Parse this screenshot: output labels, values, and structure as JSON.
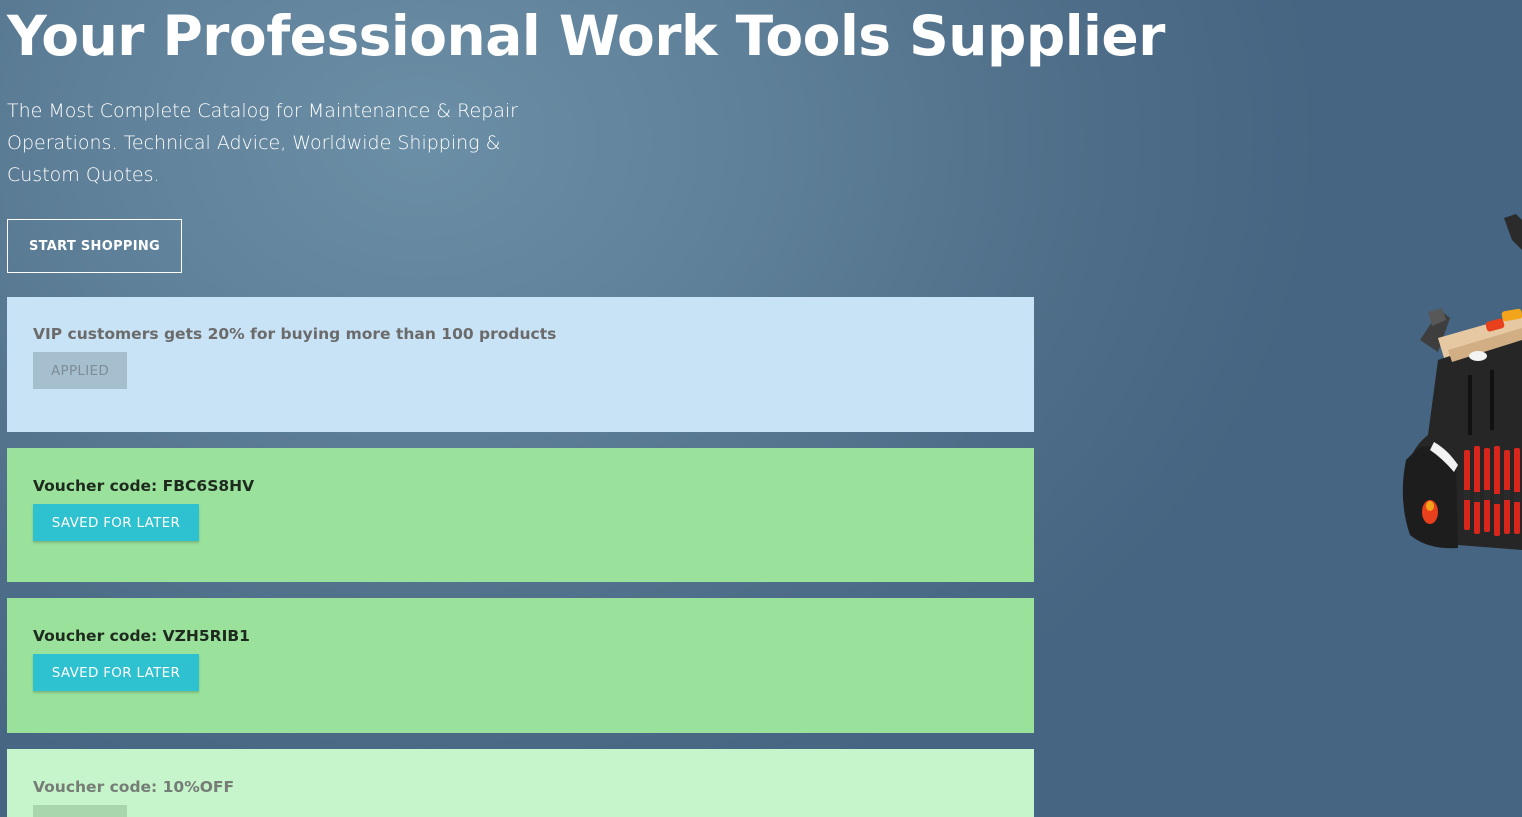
{
  "hero": {
    "title": "Your Professional Work Tools Supplier",
    "subtitle": "The Most Complete Catalog for Maintenance & Repair Operations. Technical Advice, Worldwide Shipping & Custom Quotes.",
    "cta_label": "START SHOPPING"
  },
  "vouchers": [
    {
      "text": "VIP customers gets 20% for buying more than 100 products",
      "button_label": "APPLIED",
      "state": "applied"
    },
    {
      "text": "Voucher code: FBC6S8HV",
      "button_label": "SAVED FOR LATER",
      "state": "saved"
    },
    {
      "text": "Voucher code: VZH5RIB1",
      "button_label": "SAVED FOR LATER",
      "state": "saved"
    },
    {
      "text": "Voucher code: 10%OFF",
      "button_label": "",
      "state": "disabled"
    }
  ],
  "colors": {
    "background": "#5e7f98",
    "vip_card": "#c8e2f6",
    "voucher_card": "#9ae29c",
    "voucher_card_faded": "#c6f4cb",
    "saved_button": "#2ec1cf",
    "applied_button": "#a6bfcf"
  },
  "images": {
    "hero_product": "tool-bag-image"
  }
}
